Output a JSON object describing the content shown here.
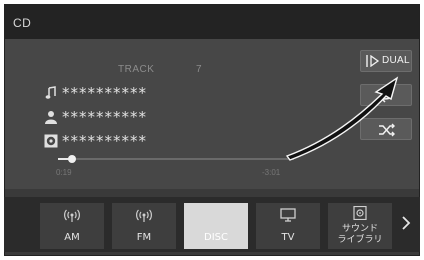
{
  "window": {
    "title": "CD"
  },
  "now_playing": {
    "track_label": "TRACK",
    "track_number": "7",
    "title": "**********",
    "artist": "**********",
    "album": "**********",
    "icons": {
      "title": "music-note-icon",
      "artist": "person-icon",
      "album": "disc-icon"
    }
  },
  "progress": {
    "elapsed": "0:19",
    "remaining": "-3:01",
    "fraction": 0.06
  },
  "side_buttons": {
    "dual_label": "DUAL",
    "icons": {
      "dual": "play-bar-icon",
      "repeat": "repeat-icon",
      "shuffle": "shuffle-icon"
    }
  },
  "tabs": [
    {
      "label": "AM",
      "icon": "radio-wave-icon",
      "active": false
    },
    {
      "label": "FM",
      "icon": "radio-wave-icon",
      "active": false
    },
    {
      "label": "DISC",
      "icon": "",
      "active": true
    },
    {
      "label": "TV",
      "icon": "tv-icon",
      "active": false
    },
    {
      "label_line1": "サウンド",
      "label_line2": "ライブラリ",
      "icon": "sound-library-icon",
      "active": false
    }
  ],
  "pager": {
    "pages": 3
  },
  "colors": {
    "background": "#3a3a3a",
    "active_tab": "#d9d9d9",
    "text": "#e0e0e0"
  }
}
